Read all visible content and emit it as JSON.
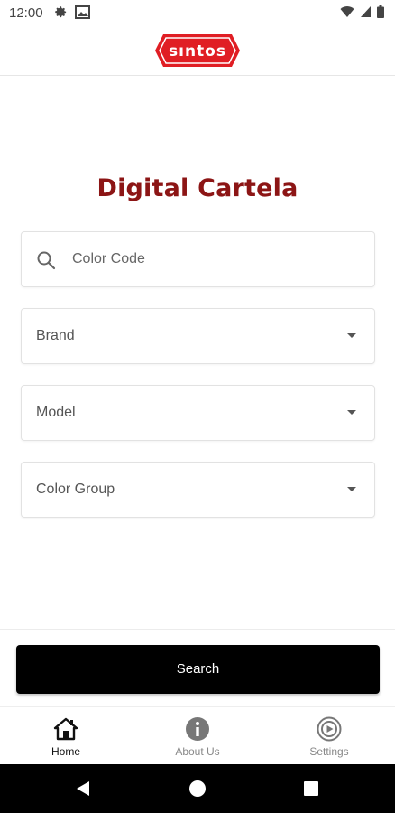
{
  "status_bar": {
    "time": "12:00",
    "left_icons": [
      "gear-icon",
      "image-notification-icon"
    ],
    "right_icons": [
      "wifi-icon",
      "cell-signal-icon",
      "battery-icon"
    ]
  },
  "header": {
    "logo_text": "sintos",
    "brand_color": "#e01e24"
  },
  "main": {
    "title": "Digital Cartela",
    "title_color": "#8c1515",
    "search": {
      "placeholder": "Color Code",
      "value": "",
      "icon": "search-icon"
    },
    "dropdowns": [
      {
        "label": "Brand"
      },
      {
        "label": "Model"
      },
      {
        "label": "Color Group"
      }
    ],
    "search_button_label": "Search"
  },
  "bottom_nav": {
    "items": [
      {
        "label": "Home",
        "icon": "home-icon",
        "active": true
      },
      {
        "label": "About Us",
        "icon": "info-icon",
        "active": false
      },
      {
        "label": "Settings",
        "icon": "settings-play-icon",
        "active": false
      }
    ]
  },
  "system_nav": {
    "buttons": [
      "back-icon",
      "home-circle-icon",
      "recents-icon"
    ]
  }
}
